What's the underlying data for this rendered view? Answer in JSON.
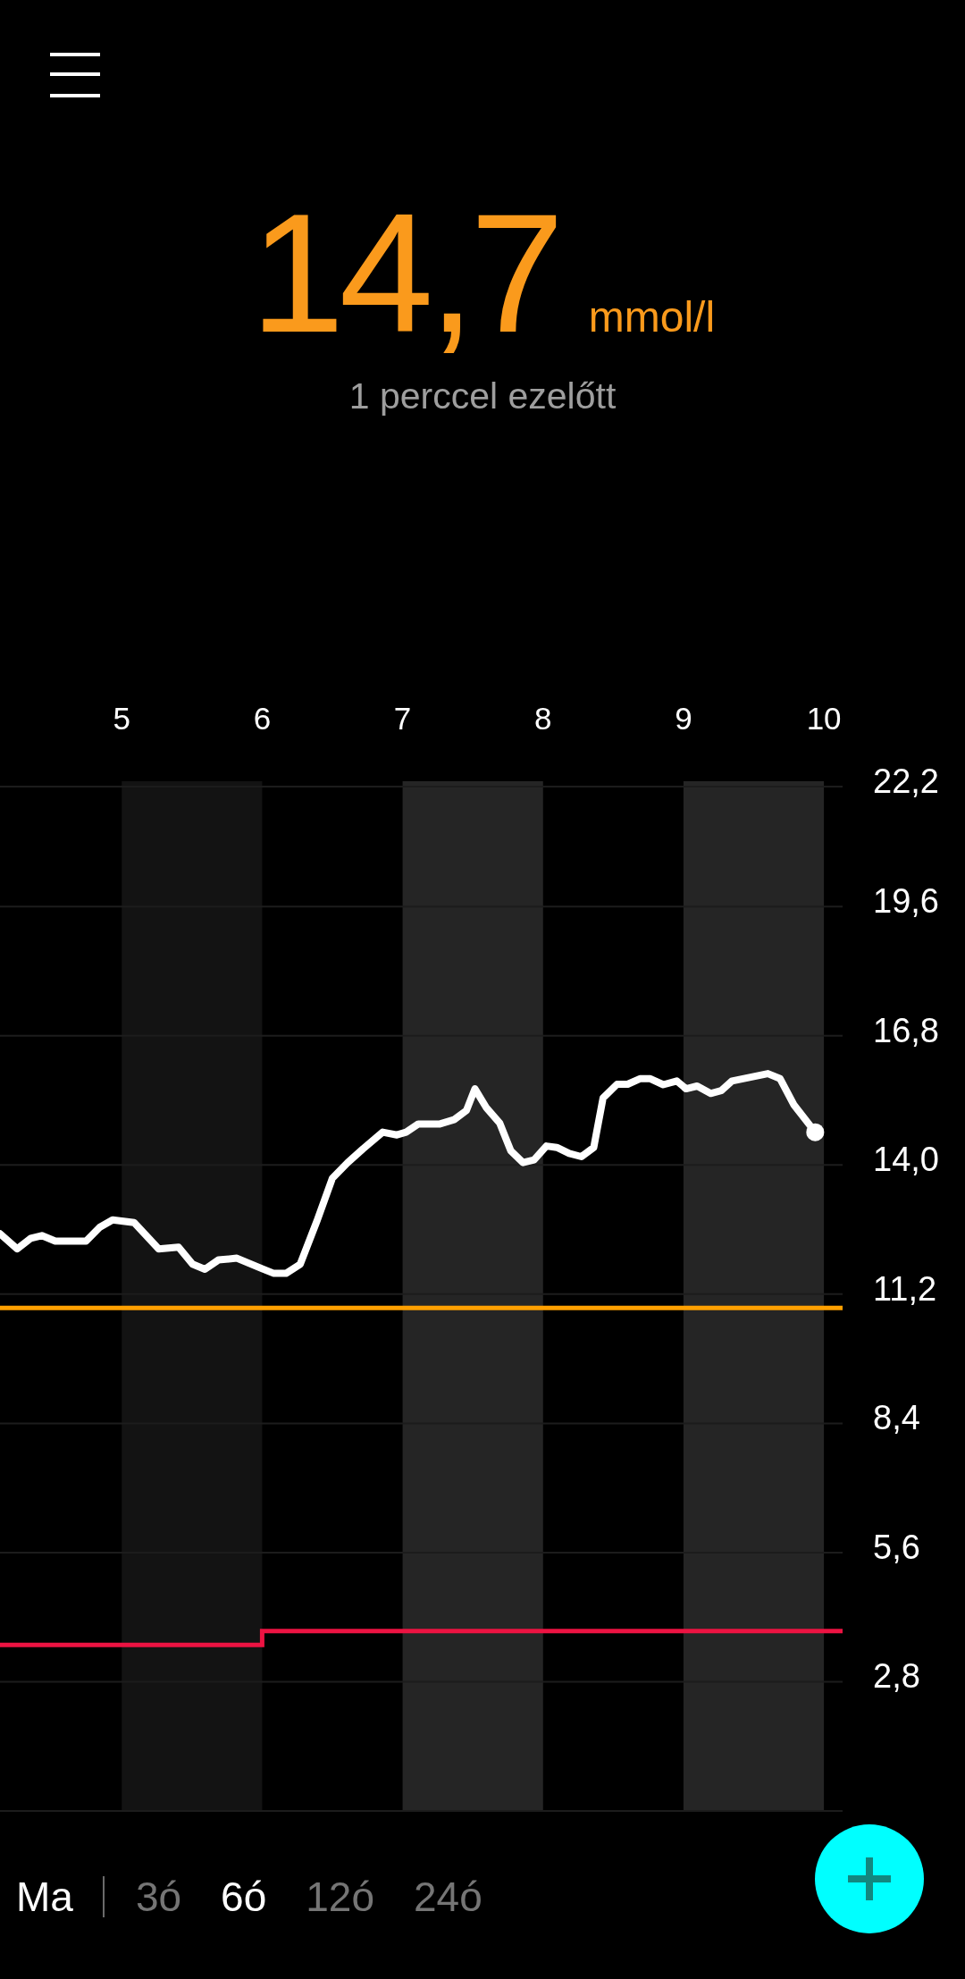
{
  "reading": {
    "value": "14,7",
    "unit": "mmol/l",
    "age": "1 perccel ezelőtt"
  },
  "chart": {
    "chart_data": {
      "type": "line",
      "x": [
        4.133,
        4.256,
        4.352,
        4.431,
        4.527,
        4.746,
        4.843,
        4.935,
        5.088,
        5.263,
        5.404,
        5.504,
        5.592,
        5.688,
        5.82,
        6,
        6,
        6.083,
        6.17,
        6.271,
        6.389,
        6.499,
        6.608,
        6.718,
        6.858,
        6.959,
        7.025,
        7.112,
        7.266,
        7.366,
        7.454,
        7.515,
        7.594,
        7.691,
        7.77,
        7.857,
        7.936,
        8.024,
        8.098,
        8.186,
        8.273,
        8.361,
        8.427,
        8.527,
        8.602,
        8.69,
        8.764,
        8.856,
        8.952,
        9.018,
        9.097,
        9.193,
        9.268,
        9.346,
        9.601,
        9.688,
        9.785,
        9.938,
        10.133
      ],
      "series": [
        {
          "color": "#ffffff",
          "values": [
            12.51,
            12.18,
            12.41,
            12.47,
            12.35,
            12.35,
            12.65,
            12.81,
            12.75,
            12.18,
            12.22,
            11.85,
            11.74,
            11.94,
            11.98,
            11.75,
            11.75,
            11.65,
            11.65,
            11.85,
            12.78,
            13.71,
            14.05,
            14.35,
            14.71,
            14.65,
            14.71,
            14.89,
            14.89,
            14.98,
            15.18,
            15.65,
            15.25,
            14.91,
            14.31,
            14.05,
            14.11,
            14.41,
            14.38,
            14.25,
            14.18,
            14.38,
            15.45,
            15.75,
            15.75,
            15.87,
            15.87,
            15.74,
            15.82,
            15.65,
            15.71,
            15.55,
            15.61,
            15.82,
            15.98,
            15.87,
            15.31,
            14.71,
            null
          ]
        },
        {
          "color": "#ffa000",
          "values": [
            10.9,
            10.9,
            10.9,
            10.9,
            10.9,
            10.9,
            10.9,
            10.9,
            10.9,
            10.9,
            10.9,
            10.9,
            10.9,
            10.9,
            10.9,
            10.9,
            10.9,
            10.9,
            10.9,
            10.9,
            10.9,
            10.9,
            10.9,
            10.9,
            10.9,
            10.9,
            10.9,
            10.9,
            10.9,
            10.9,
            10.9,
            10.9,
            10.9,
            10.9,
            10.9,
            10.9,
            10.9,
            10.9,
            10.9,
            10.9,
            10.9,
            10.9,
            10.9,
            10.9,
            10.9,
            10.9,
            10.9,
            10.9,
            10.9,
            10.9,
            10.9,
            10.9,
            10.9,
            10.9,
            10.9,
            10.9,
            10.9,
            10.9,
            10.9
          ]
        },
        {
          "color": "#ec1342",
          "values": [
            3.6,
            3.6,
            3.6,
            3.6,
            3.6,
            3.6,
            3.6,
            3.6,
            3.6,
            3.6,
            3.6,
            3.6,
            3.6,
            3.6,
            3.6,
            3.6,
            3.9,
            3.9,
            3.9,
            3.9,
            3.9,
            3.9,
            3.9,
            3.9,
            3.9,
            3.9,
            3.9,
            3.9,
            3.9,
            3.9,
            3.9,
            3.9,
            3.9,
            3.9,
            3.9,
            3.9,
            3.9,
            3.9,
            3.9,
            3.9,
            3.9,
            3.9,
            3.9,
            3.9,
            3.9,
            3.9,
            3.9,
            3.9,
            3.9,
            3.9,
            3.9,
            3.9,
            3.9,
            3.9,
            3.9,
            3.9,
            3.9,
            3.9,
            3.9
          ]
        }
      ],
      "xlim": [
        4.133,
        10.133
      ],
      "ylim": [
        0,
        22.2
      ],
      "xticks": [
        5,
        6,
        7,
        8,
        9,
        10
      ],
      "yticks": [
        {
          "value": 2.8,
          "label": "2,8"
        },
        {
          "value": 5.6,
          "label": "5,6"
        },
        {
          "value": 8.4,
          "label": "8,4"
        },
        {
          "value": 11.2,
          "label": "11,2"
        },
        {
          "value": 14,
          "label": "14,0"
        },
        {
          "value": 16.8,
          "label": "16,8"
        },
        {
          "value": 19.6,
          "label": "19,6"
        },
        {
          "value": 22.2,
          "label": "22,2"
        }
      ],
      "grid": true,
      "bands": [
        {
          "axis": "x",
          "from": 5,
          "to": 6,
          "color": "#131313"
        },
        {
          "axis": "x",
          "from": 7,
          "to": 8,
          "color": "#252525"
        },
        {
          "axis": "x",
          "from": 9,
          "to": 10,
          "color": "#252525"
        }
      ]
    }
  },
  "range_bar": {
    "today": "Ma",
    "ranges": [
      {
        "label": "3ó",
        "selected": false
      },
      {
        "label": "6ó",
        "selected": true
      },
      {
        "label": "12ó",
        "selected": false
      },
      {
        "label": "24ó",
        "selected": false
      }
    ]
  }
}
